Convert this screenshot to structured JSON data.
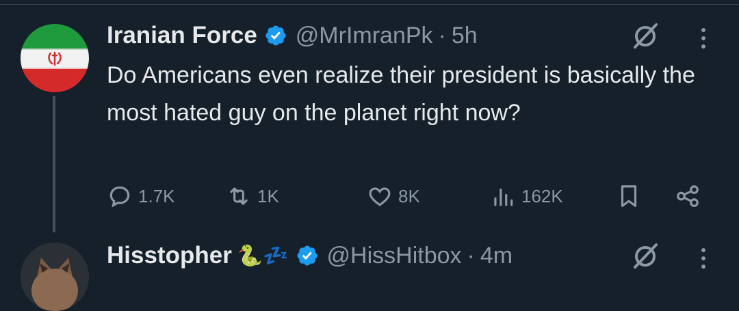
{
  "tweets": [
    {
      "display_name": "Iranian Force",
      "handle": "@MrImranPk",
      "separator": "·",
      "time": "5h",
      "text": "Do Americans even realize their president is basically the most hated guy on the planet right now?",
      "stats": {
        "replies": "1.7K",
        "reposts": "1K",
        "likes": "8K",
        "views": "162K"
      }
    },
    {
      "display_name": "Hisstopher",
      "emoji": "🐍💤",
      "handle": "@HissHitbox",
      "separator": "·",
      "time": "4m"
    }
  ],
  "icons": {
    "verified": "verified-badge-icon",
    "grok": "grok-icon",
    "more": "more-icon",
    "reply": "reply-icon",
    "repost": "repost-icon",
    "like": "like-icon",
    "views": "views-icon",
    "bookmark": "bookmark-icon",
    "share": "share-icon"
  },
  "colors": {
    "background": "#15202b",
    "text": "#e7e9ea",
    "muted": "#8b98a5",
    "verified_blue": "#1d9bf0",
    "divider": "#38444d"
  }
}
